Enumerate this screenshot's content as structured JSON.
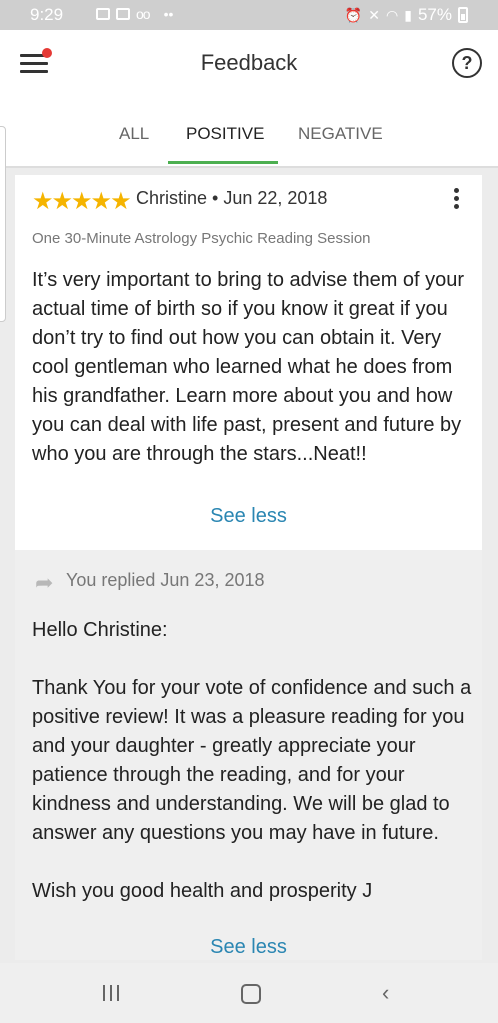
{
  "status_bar": {
    "time": "9:29",
    "battery": "57%"
  },
  "header": {
    "title": "Feedback"
  },
  "tabs": [
    {
      "label": "ALL",
      "selected": false
    },
    {
      "label": "POSITIVE",
      "selected": true
    },
    {
      "label": "NEGATIVE",
      "selected": false
    }
  ],
  "review": {
    "stars": "★★★★★",
    "rating": 5,
    "reviewer": "Christine • Jun 22, 2018",
    "session": "One 30-Minute Astrology Psychic Reading Session",
    "text": "It’s very important to bring to advise them of your actual time of birth so if you know it great if you don’t try to find out how you can obtain it. Very cool gentleman who learned what he does from his grandfather. Learn more about you and how you can deal with life past, present and future by who you are through the stars...Neat!!",
    "see_less": "See less"
  },
  "reply": {
    "date": "You replied Jun 23, 2018",
    "text": "Hello Christine:\n\nThank You for your vote of confidence and such a positive review! It was a pleasure reading for you and your daughter - greatly appreciate your patience through the reading, and for your kindness and understanding. We will be glad to answer any questions you may have in future.\n\nWish you good health and prosperity J",
    "see_less": "See less"
  },
  "colors": {
    "accent_green": "#4caf50",
    "link_blue": "#2a86b2",
    "star_gold": "#f5b400",
    "notification_red": "#e53935"
  }
}
